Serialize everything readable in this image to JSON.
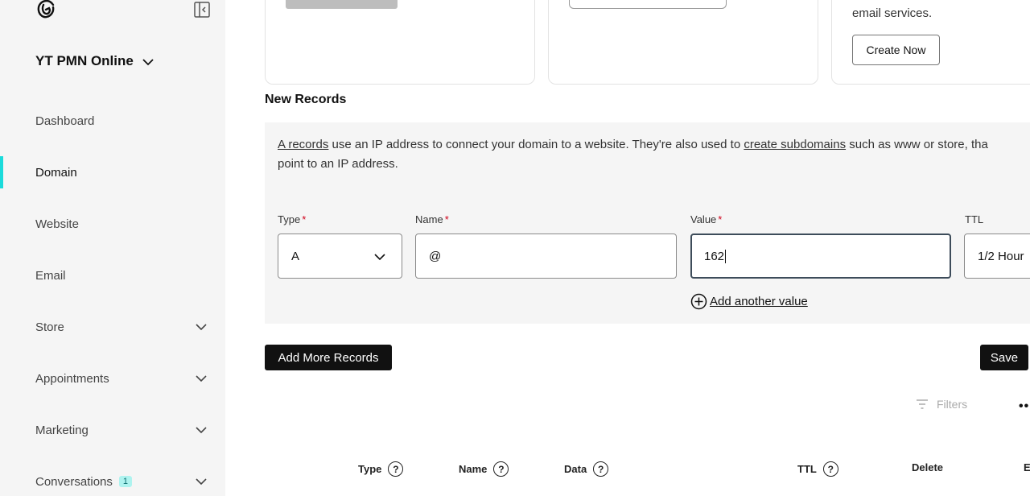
{
  "sidebar": {
    "account_name": "YT PMN Online",
    "items": [
      {
        "label": "Dashboard",
        "has_chevron": false
      },
      {
        "label": "Domain",
        "has_chevron": false,
        "active": true
      },
      {
        "label": "Website",
        "has_chevron": false
      },
      {
        "label": "Email",
        "has_chevron": false
      },
      {
        "label": "Store",
        "has_chevron": true
      },
      {
        "label": "Appointments",
        "has_chevron": true
      },
      {
        "label": "Marketing",
        "has_chevron": true
      },
      {
        "label": "Conversations",
        "has_chevron": true,
        "badge": "1"
      }
    ]
  },
  "cards": {
    "card3_text": "email services.",
    "create_now_label": "Create Now"
  },
  "new_records": {
    "title": "New Records",
    "desc_link1": "A records",
    "desc_text1": " use an IP address to connect your domain to a website. They're also used to ",
    "desc_link2": "create subdomains",
    "desc_text2": " such as www or store, tha",
    "desc_line2": "point to an IP address.",
    "fields": {
      "type_label": "Type",
      "type_value": "A",
      "name_label": "Name",
      "name_value": "@",
      "value_label": "Value",
      "value_value": "162",
      "ttl_label": "TTL",
      "ttl_value": "1/2 Hour",
      "required_mark": "*"
    },
    "add_another_value": "Add another value",
    "add_more_records": "Add More Records",
    "save": "Save"
  },
  "table": {
    "filters_label": "Filters",
    "more_label": "••",
    "headers": [
      "Type",
      "Name",
      "Data",
      "TTL",
      "Delete",
      "E"
    ],
    "help_glyph": "?"
  },
  "colors": {
    "accent": "#1bdbdb",
    "dark_button": "#111111",
    "sidebar_bg": "#f5f5f5",
    "required": "#d0021b"
  }
}
